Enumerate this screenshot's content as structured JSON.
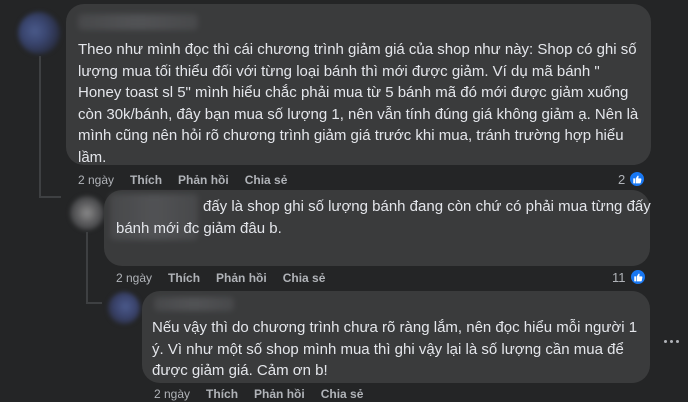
{
  "comments": [
    {
      "text": "Theo như mình đọc thì cái chương trình giảm giá của shop như này: Shop có ghi số\nlượng mua tối thiểu đối với từng loại bánh thì mới được giảm. Ví dụ mã bánh \"\nHoney toast sl 5\" mình hiểu chắc phải mua từ 5 bánh mã đó mới được giảm xuống\ncòn 30k/bánh, đây bạn mua số lượng 1, nên vẫn tính đúng giá không giảm ạ. Nên là\nmình cũng nên hỏi rõ chương trình giảm giá trước khi mua, tránh trường hợp hiểu\nlầm.",
      "time": "2 ngày",
      "like": "Thích",
      "reply": "Phản hồi",
      "share": "Chia sẻ",
      "reaction_count": "2"
    },
    {
      "text_first": "đấy là shop ghi số lượng bánh đang còn chứ có phải mua từng đấy",
      "text": "bánh mới đc giảm đâu b.",
      "time": "2 ngày",
      "like": "Thích",
      "reply": "Phản hồi",
      "share": "Chia sẻ",
      "reaction_count": "11"
    },
    {
      "text": "Nếu vậy thì do chương trình chưa rõ ràng lắm, nên đọc hiểu mỗi người 1\ný. Vì như một số shop mình mua thì ghi vậy lại là số lượng cần mua để\nđược giảm giá. Cảm ơn b!",
      "time": "2 ngày",
      "like": "Thích",
      "reply": "Phản hồi",
      "share": "Chia sẻ"
    }
  ],
  "icons": {
    "reaction": "like-icon",
    "more": "more-options-icon"
  },
  "colors": {
    "background": "#242526",
    "bubble": "#3a3b3c",
    "text": "#e4e6eb",
    "secondary_text": "#b0b3b8",
    "like_blue": "#1877f2"
  }
}
